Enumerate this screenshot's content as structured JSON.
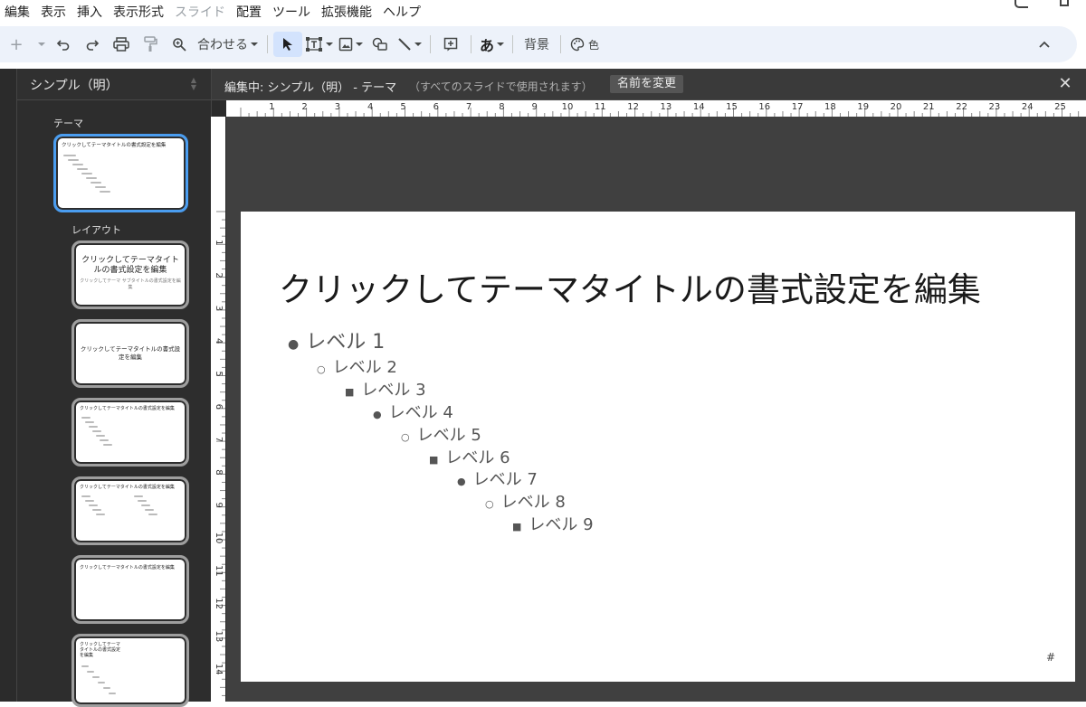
{
  "menu": [
    "編集",
    "表示",
    "挿入",
    "表示形式",
    "スライド",
    "配置",
    "ツール",
    "拡張機能",
    "ヘルプ"
  ],
  "menu_disabled": [
    4
  ],
  "toolbar": {
    "zoom_label": "合わせる",
    "background_label": "背景",
    "color_label": "色",
    "text_label": "あ",
    "icons": [
      "add-icon",
      "undo-icon",
      "redo-icon",
      "print-icon",
      "paint-format-icon",
      "zoom-icon",
      "select-icon",
      "text-box-icon",
      "image-icon",
      "shape-icon",
      "line-icon",
      "comment-icon",
      "input-tools-icon",
      "palette-icon",
      "collapse-icon"
    ]
  },
  "sidebar": {
    "title": "シンプル（明）",
    "theme_label": "テーマ",
    "layouts_label": "レイアウト",
    "theme_thumb_title": "クリックしてテーマタイトルの書式設定を編集",
    "layouts": [
      {
        "title": "クリックしてテーマタイトルの書式設定を編集",
        "subtitle": "クリックしてテーマ サブタイトルの書式設定を編集"
      },
      {
        "title": "クリックしてテーマタイトルの書式設定を編集"
      },
      {
        "title": "クリックしてテーマタイトルの書式設定を編集"
      },
      {
        "title": "クリックしてテーマタイトルの書式設定を編集"
      },
      {
        "title": "クリックしてテーマタイトルの書式設定を編集"
      },
      {
        "title": "クリックしてテーマタイトルの書式設定を編集"
      }
    ]
  },
  "editor": {
    "title": "編集中: シンプル（明） - テーマ",
    "note": "（すべてのスライドで使用されます）",
    "rename_label": "名前を変更",
    "close_icon": "close-icon"
  },
  "ruler_h": [
    "1",
    "2",
    "3",
    "4",
    "5",
    "6",
    "7",
    "8",
    "9",
    "10",
    "11",
    "12",
    "13",
    "14",
    "15",
    "16",
    "17",
    "18",
    "19",
    "20",
    "21",
    "22",
    "23",
    "24",
    "25"
  ],
  "ruler_v": [
    "1",
    "2",
    "3",
    "4",
    "5",
    "6",
    "7",
    "8",
    "9",
    "10",
    "11",
    "12",
    "13",
    "14"
  ],
  "slide": {
    "title": "クリックしてテーマタイトルの書式設定を編集",
    "levels": [
      {
        "marker": "●",
        "text": "レベル 1"
      },
      {
        "marker": "○",
        "text": "レベル 2"
      },
      {
        "marker": "■",
        "text": "レベル 3"
      },
      {
        "marker": "●",
        "text": "レベル 4"
      },
      {
        "marker": "○",
        "text": "レベル 5"
      },
      {
        "marker": "■",
        "text": "レベル 6"
      },
      {
        "marker": "●",
        "text": "レベル 7"
      },
      {
        "marker": "○",
        "text": "レベル 8"
      },
      {
        "marker": "■",
        "text": "レベル 9"
      }
    ],
    "slide_number": "#"
  },
  "colors": {
    "accent": "#4a9df0",
    "toolbar_bg": "#edf2fa",
    "editor_bg": "#2b2b2b",
    "canvas_bg": "#404040"
  }
}
